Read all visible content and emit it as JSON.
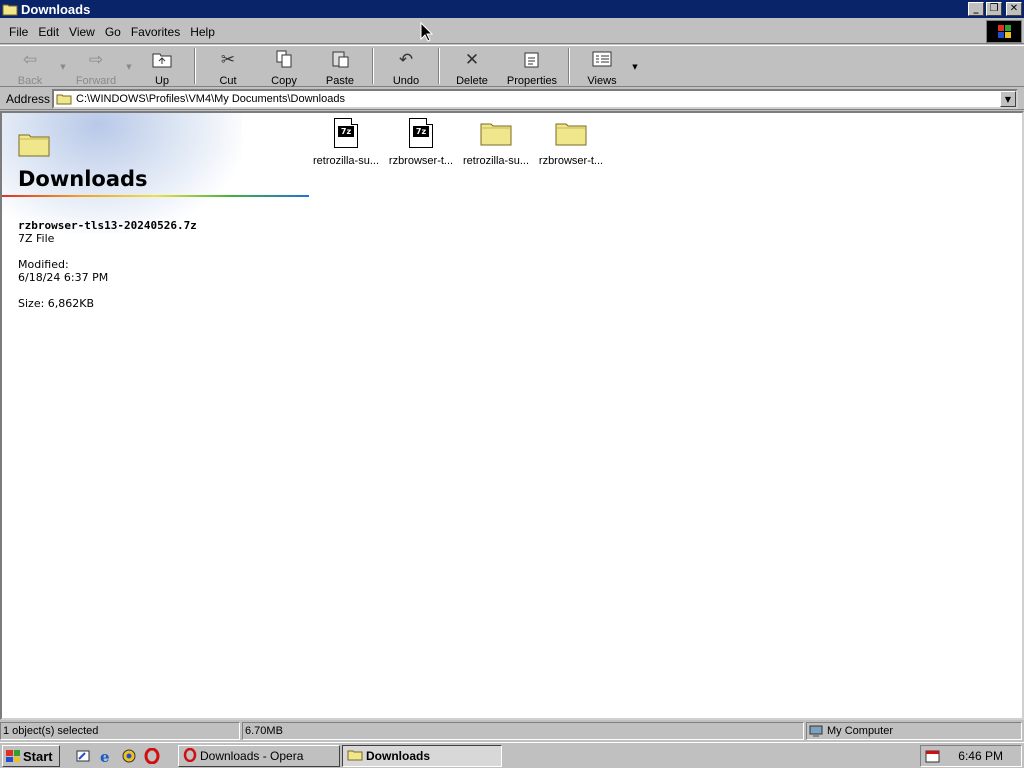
{
  "window": {
    "title": "Downloads",
    "controls": [
      "_",
      "❐",
      "✕"
    ]
  },
  "menu": [
    {
      "label": "File",
      "key": "F"
    },
    {
      "label": "Edit",
      "key": "E"
    },
    {
      "label": "View",
      "key": "V"
    },
    {
      "label": "Go",
      "key": "G"
    },
    {
      "label": "Favorites",
      "key": "a"
    },
    {
      "label": "Help",
      "key": "H"
    }
  ],
  "toolbar": {
    "back": "Back",
    "forward": "Forward",
    "up": "Up",
    "cut": "Cut",
    "copy": "Copy",
    "paste": "Paste",
    "undo": "Undo",
    "delete": "Delete",
    "properties": "Properties",
    "views": "Views"
  },
  "address": {
    "label": "Address",
    "path": "C:\\WINDOWS\\Profiles\\VM4\\My Documents\\Downloads"
  },
  "webview": {
    "folder_title": "Downloads",
    "selected_name": "rzbrowser-tls13-20240526.7z",
    "selected_type": "7Z File",
    "modified_label": "Modified:",
    "modified_value": "6/18/24 6:37 PM",
    "size": "Size: 6,862KB"
  },
  "files": [
    {
      "label": "retrozilla-su...",
      "kind": "7z",
      "icon": "7z-file-icon"
    },
    {
      "label": "rzbrowser-t...",
      "kind": "7z",
      "icon": "7z-file-icon"
    },
    {
      "label": "retrozilla-su...",
      "kind": "folder",
      "icon": "folder-icon"
    },
    {
      "label": "rzbrowser-t...",
      "kind": "folder",
      "icon": "folder-icon"
    }
  ],
  "status": {
    "selection": "1 object(s) selected",
    "size": "6.70MB",
    "zone": "My Computer"
  },
  "taskbar": {
    "start": "Start",
    "tasks": [
      "Downloads - Opera",
      "Downloads"
    ],
    "clock": "6:46 PM"
  },
  "colors": {
    "titlebar": "#0a246a",
    "face": "#c0c0c0",
    "folder": "#f0e68c"
  }
}
